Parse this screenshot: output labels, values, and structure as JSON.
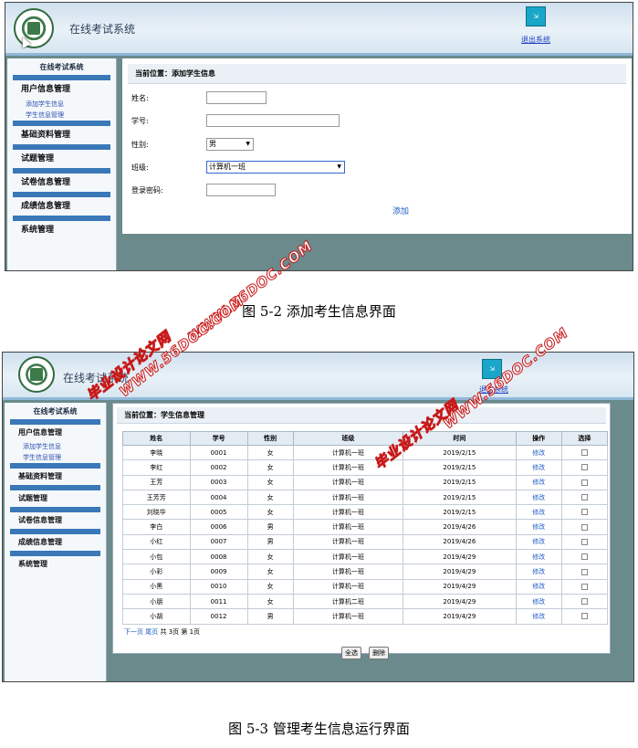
{
  "figure1": {
    "app_title": "在线考试系统",
    "exit_icon": "exit-icon",
    "exit_label": "退出系统",
    "sidebar": {
      "title": "在线考试系统",
      "groups": [
        "用户信息管理",
        "基础资料管理",
        "试题管理",
        "试卷信息管理",
        "成绩信息管理",
        "系统管理"
      ],
      "sub_items": [
        "添加学生信息",
        "学生信息管理"
      ]
    },
    "breadcrumb": "当前位置：添加学生信息",
    "form": {
      "name_label": "姓名:",
      "id_label": "学号:",
      "gender_label": "性别:",
      "gender_value": "男",
      "class_label": "班级:",
      "class_value": "计算机一班",
      "password_label": "登录密码:",
      "submit_label": "添加"
    },
    "caption": "图 5-2  添加考生信息界面"
  },
  "figure2": {
    "app_title": "在线考试系统",
    "exit_label": "退出系统",
    "sidebar": {
      "title": "在线考试系统",
      "groups": [
        "用户信息管理",
        "基础资料管理",
        "试题管理",
        "试卷信息管理",
        "成绩信息管理",
        "系统管理"
      ],
      "sub_items": [
        "添加学生信息",
        "学生信息管理"
      ]
    },
    "breadcrumb": "当前位置：学生信息管理",
    "table": {
      "headers": [
        "姓名",
        "学号",
        "性别",
        "班级",
        "时间",
        "操作",
        "选择"
      ],
      "rows": [
        [
          "李晓",
          "0001",
          "女",
          "计算机一班",
          "2019/2/15",
          "修改"
        ],
        [
          "李红",
          "0002",
          "女",
          "计算机一班",
          "2019/2/15",
          "修改"
        ],
        [
          "王芳",
          "0003",
          "女",
          "计算机一班",
          "2019/2/15",
          "修改"
        ],
        [
          "王芳芳",
          "0004",
          "女",
          "计算机一班",
          "2019/2/15",
          "修改"
        ],
        [
          "刘晓华",
          "0005",
          "女",
          "计算机一班",
          "2019/2/15",
          "修改"
        ],
        [
          "李白",
          "0006",
          "男",
          "计算机一班",
          "2019/4/26",
          "修改"
        ],
        [
          "小红",
          "0007",
          "男",
          "计算机一班",
          "2019/4/26",
          "修改"
        ],
        [
          "小包",
          "0008",
          "女",
          "计算机一班",
          "2019/4/29",
          "修改"
        ],
        [
          "小彩",
          "0009",
          "女",
          "计算机一班",
          "2019/4/29",
          "修改"
        ],
        [
          "小黑",
          "0010",
          "女",
          "计算机一班",
          "2019/4/29",
          "修改"
        ],
        [
          "小朋",
          "0011",
          "女",
          "计算机二班",
          "2019/4/29",
          "修改"
        ],
        [
          "小胡",
          "0012",
          "男",
          "计算机一班",
          "2019/4/29",
          "修改"
        ]
      ]
    },
    "pager": {
      "next": "下一页",
      "last": "尾页",
      "info": "共 3页 第 1页"
    },
    "buttons": {
      "select_all": "全选",
      "delete": "删除"
    },
    "caption": "图 5-3  管理考生信息运行界面"
  },
  "watermarks": [
    "WWW.56DOC.COM",
    "毕业设计论文网",
    "WWW.56DOC.COM",
    "毕业设计论文网",
    "WWW.56DOC.COM"
  ]
}
